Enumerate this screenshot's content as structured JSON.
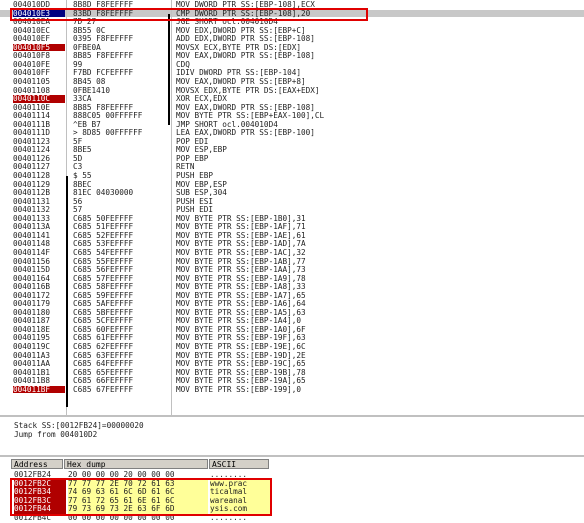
{
  "cpu": {
    "rows": [
      {
        "addr": "004010DD",
        "hex": "8B8D F8FEFFFF",
        "dis": "MOV DWORD PTR SS:[EBP-108],ECX"
      },
      {
        "addr": "004010E3",
        "hex": "83BD F8FEFFFF",
        "dis": "CMP DWORD PTR SS:[EBP-108],20",
        "state": "current"
      },
      {
        "addr": "004010EA",
        "hex": "7D 27",
        "dis": "JGE SHORT ocl.004010D4"
      },
      {
        "addr": "004010EC",
        "hex": "8B55 0C",
        "dis": "MOV EDX,DWORD PTR SS:[EBP+C]"
      },
      {
        "addr": "004010EF",
        "hex": "0395 F8FEFFFF",
        "dis": "ADD EDX,DWORD PTR SS:[EBP-108]"
      },
      {
        "addr": "004010F5",
        "hex": "0FBE0A",
        "dis": "MOVSX ECX,BYTE PTR DS:[EDX]",
        "state": "bp"
      },
      {
        "addr": "004010F8",
        "hex": "8B85 F8FEFFFF",
        "dis": "MOV EAX,DWORD PTR SS:[EBP-108]"
      },
      {
        "addr": "004010FE",
        "hex": "99",
        "dis": "CDQ"
      },
      {
        "addr": "004010FF",
        "hex": "F7BD FCFEFFFF",
        "dis": "IDIV DWORD PTR SS:[EBP-104]"
      },
      {
        "addr": "00401105",
        "hex": "8B45 08",
        "dis": "MOV EAX,DWORD PTR SS:[EBP+8]"
      },
      {
        "addr": "00401108",
        "hex": "0FBE1410",
        "dis": "MOVSX EDX,BYTE PTR DS:[EAX+EDX]"
      },
      {
        "addr": "0040110C",
        "hex": "33CA",
        "dis": "XOR ECX,EDX",
        "state": "bp"
      },
      {
        "addr": "0040110E",
        "hex": "8B85 F8FEFFFF",
        "dis": "MOV EAX,DWORD PTR SS:[EBP-108]"
      },
      {
        "addr": "00401114",
        "hex": "888C05 00FFFFFF",
        "dis": "MOV BYTE PTR SS:[EBP+EAX-100],CL"
      },
      {
        "addr": "0040111B",
        "hex": "^EB B7",
        "dis": "JMP SHORT ocl.004010D4"
      },
      {
        "addr": "0040111D",
        "hex": "> 8D85 00FFFFFF",
        "dis": "LEA EAX,DWORD PTR SS:[EBP-100]"
      },
      {
        "addr": "00401123",
        "hex": "5F",
        "dis": "POP EDI"
      },
      {
        "addr": "00401124",
        "hex": "8BE5",
        "dis": "MOV ESP,EBP"
      },
      {
        "addr": "00401126",
        "hex": "5D",
        "dis": "POP EBP"
      },
      {
        "addr": "00401127",
        "hex": "C3",
        "dis": "RETN"
      },
      {
        "addr": "00401128",
        "hex": "$ 55",
        "dis": "PUSH EBP"
      },
      {
        "addr": "00401129",
        "hex": "8BEC",
        "dis": "MOV EBP,ESP"
      },
      {
        "addr": "0040112B",
        "hex": "81EC 04030000",
        "dis": "SUB ESP,304"
      },
      {
        "addr": "00401131",
        "hex": "56",
        "dis": "PUSH ESI"
      },
      {
        "addr": "00401132",
        "hex": "57",
        "dis": "PUSH EDI"
      },
      {
        "addr": "00401133",
        "hex": "C685 50FEFFFF",
        "dis": "MOV BYTE PTR SS:[EBP-1B0],31"
      },
      {
        "addr": "0040113A",
        "hex": "C685 51FEFFFF",
        "dis": "MOV BYTE PTR SS:[EBP-1AF],71"
      },
      {
        "addr": "00401141",
        "hex": "C685 52FEFFFF",
        "dis": "MOV BYTE PTR SS:[EBP-1AE],61"
      },
      {
        "addr": "00401148",
        "hex": "C685 53FEFFFF",
        "dis": "MOV BYTE PTR SS:[EBP-1AD],7A"
      },
      {
        "addr": "0040114F",
        "hex": "C685 54FEFFFF",
        "dis": "MOV BYTE PTR SS:[EBP-1AC],32"
      },
      {
        "addr": "00401156",
        "hex": "C685 55FEFFFF",
        "dis": "MOV BYTE PTR SS:[EBP-1AB],77"
      },
      {
        "addr": "0040115D",
        "hex": "C685 56FEFFFF",
        "dis": "MOV BYTE PTR SS:[EBP-1AA],73"
      },
      {
        "addr": "00401164",
        "hex": "C685 57FEFFFF",
        "dis": "MOV BYTE PTR SS:[EBP-1A9],78"
      },
      {
        "addr": "0040116B",
        "hex": "C685 58FEFFFF",
        "dis": "MOV BYTE PTR SS:[EBP-1A8],33"
      },
      {
        "addr": "00401172",
        "hex": "C685 59FEFFFF",
        "dis": "MOV BYTE PTR SS:[EBP-1A7],65"
      },
      {
        "addr": "00401179",
        "hex": "C685 5AFEFFFF",
        "dis": "MOV BYTE PTR SS:[EBP-1A6],64"
      },
      {
        "addr": "00401180",
        "hex": "C685 5BFEFFFF",
        "dis": "MOV BYTE PTR SS:[EBP-1A5],63"
      },
      {
        "addr": "00401187",
        "hex": "C685 5CFEFFFF",
        "dis": "MOV BYTE PTR SS:[EBP-1A4],0"
      },
      {
        "addr": "0040118E",
        "hex": "C685 60FEFFFF",
        "dis": "MOV BYTE PTR SS:[EBP-1A0],6F"
      },
      {
        "addr": "00401195",
        "hex": "C685 61FEFFFF",
        "dis": "MOV BYTE PTR SS:[EBP-19F],63"
      },
      {
        "addr": "0040119C",
        "hex": "C685 62FEFFFF",
        "dis": "MOV BYTE PTR SS:[EBP-19E],6C"
      },
      {
        "addr": "004011A3",
        "hex": "C685 63FEFFFF",
        "dis": "MOV BYTE PTR SS:[EBP-19D],2E"
      },
      {
        "addr": "004011AA",
        "hex": "C685 64FEFFFF",
        "dis": "MOV BYTE PTR SS:[EBP-19C],65"
      },
      {
        "addr": "004011B1",
        "hex": "C685 65FEFFFF",
        "dis": "MOV BYTE PTR SS:[EBP-19B],78"
      },
      {
        "addr": "004011B8",
        "hex": "C685 66FEFFFF",
        "dis": "MOV BYTE PTR SS:[EBP-19A],65"
      },
      {
        "addr": "004011BF",
        "hex": "C685 67FEFFFF",
        "dis": "MOV BYTE PTR SS:[EBP-199],0",
        "state": "bp"
      }
    ]
  },
  "info": {
    "line1": "Stack SS:[0012FB24]=00000020",
    "line2": "Jump from 004010D2"
  },
  "dump": {
    "headers": {
      "address": "Address",
      "hex": "Hex dump",
      "ascii": "ASCII"
    },
    "rows": [
      {
        "addr": "0012FB24",
        "hex": "20 00 00 00 20 00 00 00",
        "ascii": "........"
      },
      {
        "addr": "0012FB2C",
        "hex": "77 77 77 2E 70 72 61 63",
        "ascii": "www.prac",
        "hl": true
      },
      {
        "addr": "0012FB34",
        "hex": "74 69 63 61 6C 6D 61 6C",
        "ascii": "ticalmal",
        "hl": true
      },
      {
        "addr": "0012FB3C",
        "hex": "77 61 72 65 61 6E 61 6C",
        "ascii": "wareanal",
        "hl": true
      },
      {
        "addr": "0012FB44",
        "hex": "79 73 69 73 2E 63 6F 6D",
        "ascii": "ysis.com",
        "hl": true
      },
      {
        "addr": "0012FB4C",
        "hex": "00 00 00 00 00 00 00 00",
        "ascii": "........"
      }
    ]
  },
  "colors": {
    "breakpoint": "#b00000",
    "highlight_box": "#e00000",
    "dump_highlight": "#ffff99"
  }
}
